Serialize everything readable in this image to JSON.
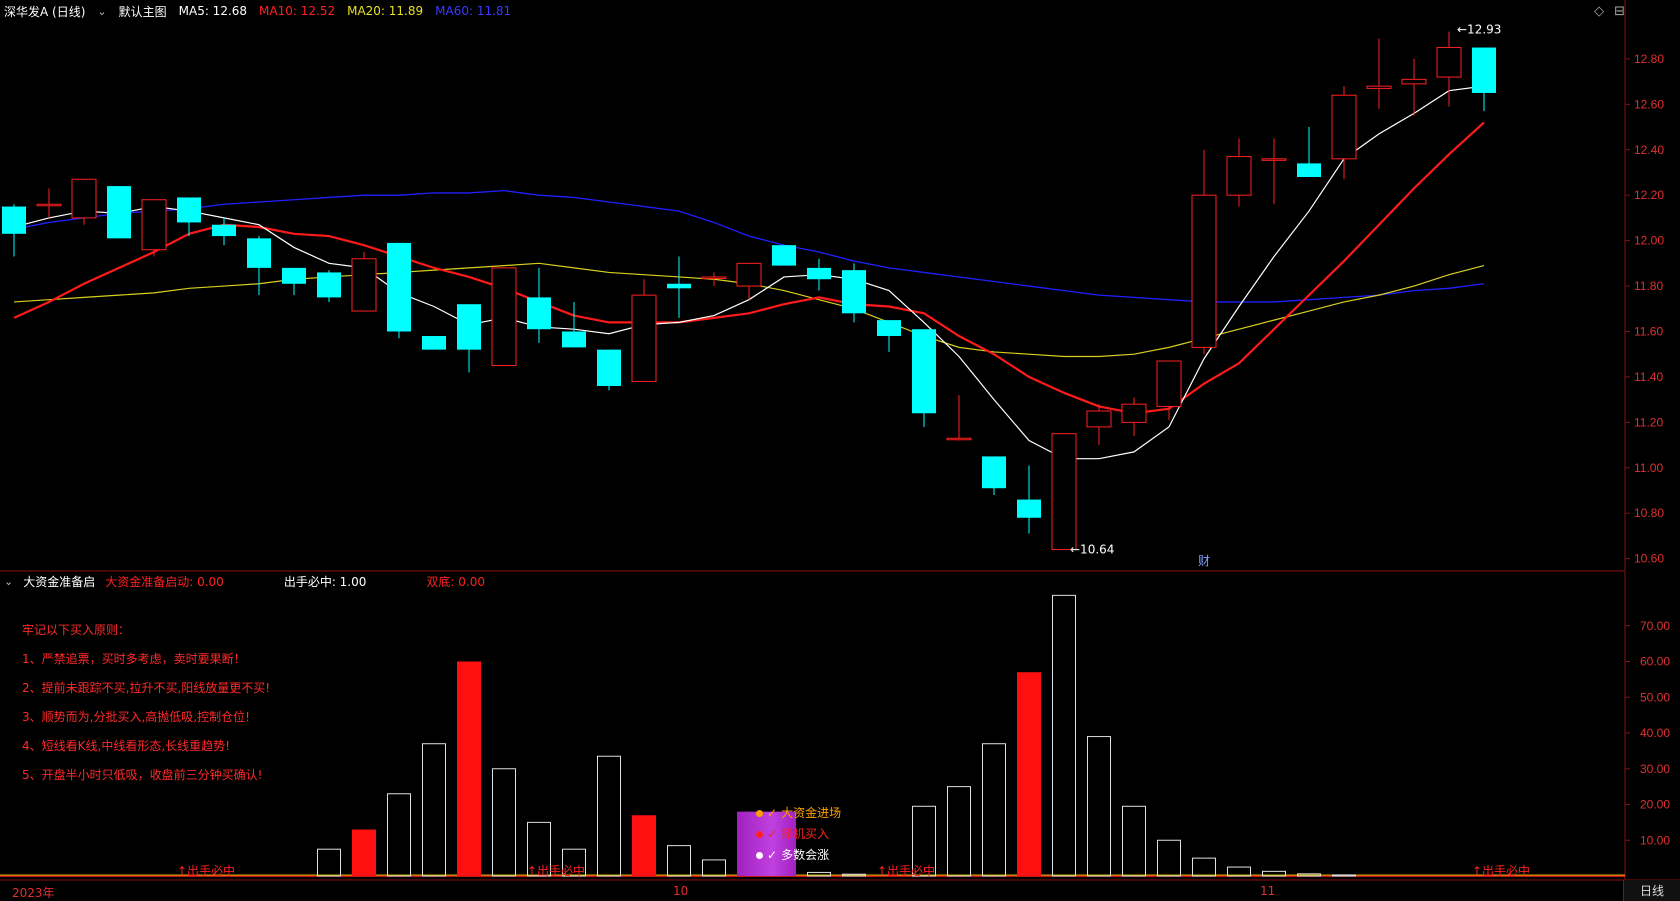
{
  "header": {
    "stock_title": "深华发A (日线)",
    "main_chart_label": "默认主图",
    "ma5": "MA5: 12.68",
    "ma10": "MA10: 12.52",
    "ma20": "MA20: 11.89",
    "ma60": "MA60: 11.81",
    "colors": {
      "ma5": "#ffffff",
      "ma10": "#ff2020",
      "ma20": "#e8e020",
      "ma60": "#2020ff"
    }
  },
  "price_axis": [
    "12.80",
    "12.60",
    "12.40",
    "12.20",
    "12.00",
    "11.80",
    "11.60",
    "11.40",
    "11.20",
    "11.00",
    "10.80",
    "10.60"
  ],
  "annotations": {
    "high": "12.93",
    "low": "10.64",
    "finance_marker": "财"
  },
  "indicator": {
    "name": "大资金准备启",
    "start_label": "大资金准备启动: 0.00",
    "hit_label": "出手必中: 1.00",
    "double_label": "双底: 0.00",
    "axis": [
      "70.00",
      "60.00",
      "50.00",
      "40.00",
      "30.00",
      "20.00",
      "10.00"
    ],
    "rules": [
      "牢记以下买入原则：",
      "1、严禁追票，买时多考虑，卖时要果断！",
      "2、提前未跟踪不买,拉升不买,阳线放量更不买!",
      "3、顺势而为,分批买入,高抛低吸,控制仓位!",
      "4、短线看K线,中线看形态,长线重趋势!",
      "5、开盘半小时只低吸，收盘前三分钟买确认!"
    ],
    "legend": [
      {
        "label": "大资金进场",
        "color": "#ffa000"
      },
      {
        "label": "择机买入",
        "color": "#ff2020"
      },
      {
        "label": "多数会涨",
        "color": "#ffffff"
      }
    ],
    "signal_label": "出手必中"
  },
  "time_axis": {
    "year": "2023年",
    "oct": "10",
    "nov": "11",
    "period": "日线"
  },
  "chart_data": {
    "type": "candlestick",
    "ylim": [
      10.55,
      12.98
    ],
    "candles": [
      [
        12.15,
        12.03,
        12.16,
        11.93
      ],
      [
        12.16,
        12.16,
        12.23,
        12.1
      ],
      [
        12.1,
        12.27,
        12.27,
        12.07
      ],
      [
        12.24,
        12.01,
        12.24,
        12.01
      ],
      [
        11.96,
        12.18,
        12.18,
        11.93
      ],
      [
        12.19,
        12.08,
        12.19,
        12.02
      ],
      [
        12.07,
        12.02,
        12.1,
        11.98
      ],
      [
        12.01,
        11.88,
        12.02,
        11.76
      ],
      [
        11.88,
        11.81,
        11.88,
        11.76
      ],
      [
        11.86,
        11.75,
        11.87,
        11.73
      ],
      [
        11.69,
        11.92,
        11.95,
        11.69
      ],
      [
        11.99,
        11.6,
        11.99,
        11.57
      ],
      [
        11.58,
        11.52,
        11.58,
        11.52
      ],
      [
        11.72,
        11.52,
        11.72,
        11.42
      ],
      [
        11.45,
        11.88,
        11.88,
        11.45
      ],
      [
        11.75,
        11.61,
        11.88,
        11.55
      ],
      [
        11.6,
        11.53,
        11.73,
        11.53
      ],
      [
        11.52,
        11.36,
        11.52,
        11.34
      ],
      [
        11.38,
        11.76,
        11.83,
        11.38
      ],
      [
        11.81,
        11.79,
        11.93,
        11.66
      ],
      [
        11.84,
        11.84,
        11.86,
        11.8
      ],
      [
        11.8,
        11.9,
        11.9,
        11.74
      ],
      [
        11.98,
        11.89,
        11.98,
        11.89
      ],
      [
        11.88,
        11.83,
        11.92,
        11.78
      ],
      [
        11.87,
        11.68,
        11.9,
        11.64
      ],
      [
        11.65,
        11.58,
        11.65,
        11.51
      ],
      [
        11.61,
        11.24,
        11.61,
        11.18
      ],
      [
        11.13,
        11.13,
        11.32,
        11.12
      ],
      [
        11.05,
        10.91,
        11.05,
        10.88
      ],
      [
        10.86,
        10.78,
        11.01,
        10.71
      ],
      [
        10.64,
        11.15,
        11.15,
        10.64
      ],
      [
        11.18,
        11.25,
        11.28,
        11.1
      ],
      [
        11.2,
        11.28,
        11.31,
        11.14
      ],
      [
        11.27,
        11.47,
        11.47,
        11.21
      ],
      [
        11.53,
        12.2,
        12.4,
        11.5
      ],
      [
        12.2,
        12.37,
        12.45,
        12.15
      ],
      [
        12.36,
        12.36,
        12.45,
        12.16
      ],
      [
        12.34,
        12.28,
        12.5,
        12.28
      ],
      [
        12.36,
        12.64,
        12.68,
        12.27
      ],
      [
        12.67,
        12.68,
        12.89,
        12.58
      ],
      [
        12.69,
        12.71,
        12.8,
        12.55
      ],
      [
        12.72,
        12.85,
        12.92,
        12.59
      ],
      [
        12.85,
        12.65,
        12.85,
        12.57
      ]
    ],
    "ma5": [
      12.06,
      12.1,
      12.13,
      12.12,
      12.15,
      12.13,
      12.1,
      12.07,
      11.97,
      11.9,
      11.88,
      11.77,
      11.71,
      11.63,
      11.66,
      11.62,
      11.61,
      11.59,
      11.63,
      11.64,
      11.67,
      11.74,
      11.84,
      11.85,
      11.83,
      11.78,
      11.64,
      11.49,
      11.3,
      11.12,
      11.04,
      11.04,
      11.07,
      11.18,
      11.48,
      11.71,
      11.93,
      12.13,
      12.36,
      12.47,
      12.56,
      12.66,
      12.68
    ],
    "ma10": [
      11.66,
      11.73,
      11.81,
      11.88,
      11.95,
      12.03,
      12.07,
      12.06,
      12.03,
      12.02,
      11.98,
      11.93,
      11.88,
      11.84,
      11.79,
      11.73,
      11.67,
      11.64,
      11.64,
      11.64,
      11.66,
      11.68,
      11.72,
      11.75,
      11.72,
      11.71,
      11.68,
      11.58,
      11.5,
      11.4,
      11.33,
      11.27,
      11.24,
      11.26,
      11.37,
      11.46,
      11.61,
      11.76,
      11.91,
      12.07,
      12.23,
      12.38,
      12.52
    ],
    "ma20": [
      11.73,
      11.74,
      11.75,
      11.76,
      11.77,
      11.79,
      11.8,
      11.81,
      11.83,
      11.84,
      11.85,
      11.86,
      11.87,
      11.88,
      11.89,
      11.9,
      11.88,
      11.86,
      11.85,
      11.84,
      11.83,
      11.81,
      11.78,
      11.74,
      11.7,
      11.64,
      11.58,
      11.53,
      11.51,
      11.5,
      11.49,
      11.49,
      11.5,
      11.53,
      11.57,
      11.61,
      11.65,
      11.69,
      11.73,
      11.76,
      11.8,
      11.85,
      11.89
    ],
    "ma60": [
      12.05,
      12.08,
      12.1,
      12.12,
      12.13,
      12.14,
      12.16,
      12.17,
      12.18,
      12.19,
      12.2,
      12.2,
      12.21,
      12.21,
      12.22,
      12.2,
      12.19,
      12.17,
      12.15,
      12.13,
      12.08,
      12.02,
      11.98,
      11.95,
      11.91,
      11.88,
      11.86,
      11.84,
      11.82,
      11.8,
      11.78,
      11.76,
      11.75,
      11.74,
      11.73,
      11.73,
      11.73,
      11.74,
      11.75,
      11.76,
      11.78,
      11.79,
      11.81
    ],
    "volume_bars": [
      {
        "i": 9,
        "v": 7.5,
        "c": "w"
      },
      {
        "i": 10,
        "v": 13,
        "c": "r"
      },
      {
        "i": 11,
        "v": 23,
        "c": "w"
      },
      {
        "i": 12,
        "v": 37,
        "c": "w"
      },
      {
        "i": 13,
        "v": 60,
        "c": "r"
      },
      {
        "i": 14,
        "v": 30,
        "c": "w"
      },
      {
        "i": 15,
        "v": 15,
        "c": "w"
      },
      {
        "i": 16,
        "v": 7.5,
        "c": "w"
      },
      {
        "i": 17,
        "v": 33.5,
        "c": "w"
      },
      {
        "i": 18,
        "v": 17,
        "c": "r"
      },
      {
        "i": 19,
        "v": 8.5,
        "c": "w"
      },
      {
        "i": 20,
        "v": 4.5,
        "c": "w"
      },
      {
        "i": 21,
        "v": 18,
        "c": "p"
      },
      {
        "i": 22,
        "v": 18,
        "c": "p"
      },
      {
        "i": 23,
        "v": 1,
        "c": "w"
      },
      {
        "i": 24,
        "v": 0.5,
        "c": "w"
      },
      {
        "i": 26,
        "v": 19.5,
        "c": "w"
      },
      {
        "i": 27,
        "v": 25,
        "c": "w"
      },
      {
        "i": 28,
        "v": 37,
        "c": "w"
      },
      {
        "i": 29,
        "v": 57,
        "c": "r"
      },
      {
        "i": 30,
        "v": 78.5,
        "c": "w"
      },
      {
        "i": 31,
        "v": 39,
        "c": "w"
      },
      {
        "i": 32,
        "v": 19.5,
        "c": "w"
      },
      {
        "i": 33,
        "v": 10,
        "c": "w"
      },
      {
        "i": 34,
        "v": 5,
        "c": "w"
      },
      {
        "i": 35,
        "v": 2.5,
        "c": "w"
      },
      {
        "i": 36,
        "v": 1.3,
        "c": "w"
      },
      {
        "i": 37,
        "v": 0.6,
        "c": "w"
      },
      {
        "i": 38,
        "v": 0.3,
        "c": "w"
      }
    ],
    "signal_positions": [
      5,
      15,
      25,
      42
    ]
  }
}
